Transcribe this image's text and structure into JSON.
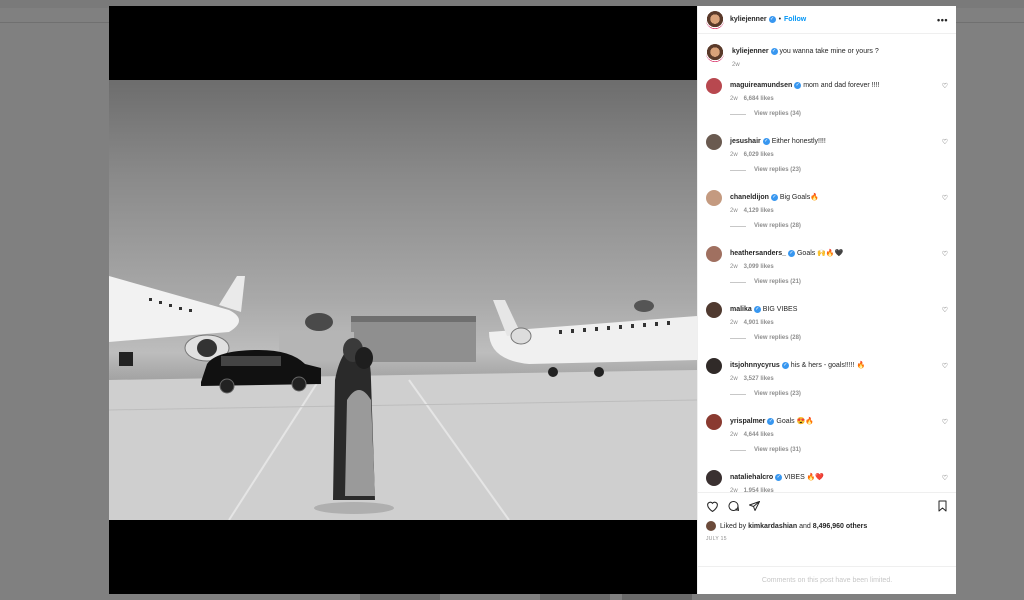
{
  "post": {
    "author": "kyliejenner",
    "follow_label": "Follow",
    "more_label": "•••",
    "caption": "you wanna take mine or yours ?",
    "caption_time": "2w"
  },
  "comments": [
    {
      "user": "maguireamundsen",
      "text": "mom and dad forever !!!!",
      "time": "2w",
      "likes": "6,684 likes",
      "replies": "View replies (34)",
      "color": "#b8484f"
    },
    {
      "user": "jesushair",
      "text": "Either honestly!!!!",
      "time": "2w",
      "likes": "6,029 likes",
      "replies": "View replies (23)",
      "color": "#6a5a50"
    },
    {
      "user": "chaneldijon",
      "text": "Big Goals🔥",
      "time": "2w",
      "likes": "4,129 likes",
      "replies": "View replies (28)",
      "color": "#c49a80"
    },
    {
      "user": "heathersanders_",
      "text": "Goals 🙌🔥🖤",
      "time": "2w",
      "likes": "3,099 likes",
      "replies": "View replies (21)",
      "color": "#a07060"
    },
    {
      "user": "malika",
      "text": "BIG VIBES",
      "time": "2w",
      "likes": "4,901 likes",
      "replies": "View replies (28)",
      "color": "#503a30"
    },
    {
      "user": "itsjohnnycyrus",
      "text": "his & hers - goals!!!!! 🔥",
      "time": "2w",
      "likes": "3,527 likes",
      "replies": "View replies (23)",
      "color": "#302a28"
    },
    {
      "user": "yrispalmer",
      "text": "Goals 😍🔥",
      "time": "2w",
      "likes": "4,644 likes",
      "replies": "View replies (31)",
      "color": "#8a3a30"
    },
    {
      "user": "nataliehalcro",
      "text": "VIBES 🔥❤️",
      "time": "2w",
      "likes": "1,954 likes",
      "replies": "",
      "color": "#3a3030"
    }
  ],
  "footer": {
    "liked_prefix": "Liked by",
    "liked_user": "kimkardashian",
    "liked_and": "and",
    "liked_count": "8,496,960 others",
    "date": "JULY 15",
    "limited": "Comments on this post have been limited."
  },
  "icons": {
    "heart": "heart-icon",
    "comment": "comment-icon",
    "share": "share-icon",
    "save": "save-icon"
  }
}
